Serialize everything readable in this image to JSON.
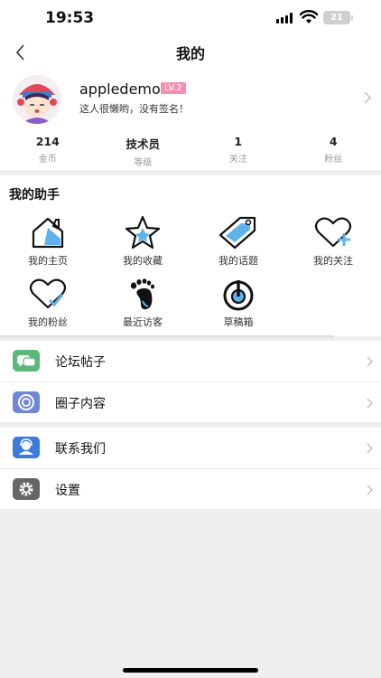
{
  "status_bar": {
    "time": "19:53",
    "battery": "21"
  },
  "nav": {
    "title": "我的"
  },
  "profile": {
    "username": "appledemo",
    "level": "LV.2",
    "signature": "这人很懒哟，没有签名！",
    "stats": [
      {
        "value": "214",
        "label": "金币"
      },
      {
        "value": "技术员",
        "label": "等级"
      },
      {
        "value": "1",
        "label": "关注"
      },
      {
        "value": "4",
        "label": "粉丝"
      }
    ]
  },
  "helper": {
    "title": "我的助手",
    "items": [
      {
        "label": "我的主页",
        "icon": "home-icon"
      },
      {
        "label": "我的收藏",
        "icon": "star-icon"
      },
      {
        "label": "我的话题",
        "icon": "tag-icon"
      },
      {
        "label": "我的关注",
        "icon": "heart-plus-icon"
      },
      {
        "label": "我的粉丝",
        "icon": "heart-check-icon"
      },
      {
        "label": "最近访客",
        "icon": "footprint-icon"
      },
      {
        "label": "草稿箱",
        "icon": "draft-icon"
      }
    ]
  },
  "menu_groups": [
    [
      {
        "label": "论坛帖子",
        "icon": "chat-icon",
        "color": "#5cb87a"
      },
      {
        "label": "圈子内容",
        "icon": "circle-icon",
        "color": "#6f86d6"
      }
    ],
    [
      {
        "label": "联系我们",
        "icon": "contact-icon",
        "color": "#3d7ad9"
      },
      {
        "label": "设置",
        "icon": "gear-icon",
        "color": "#666666"
      }
    ]
  ],
  "colors": {
    "accent": "#5db3ea",
    "level_badge": "#f48fb1"
  }
}
